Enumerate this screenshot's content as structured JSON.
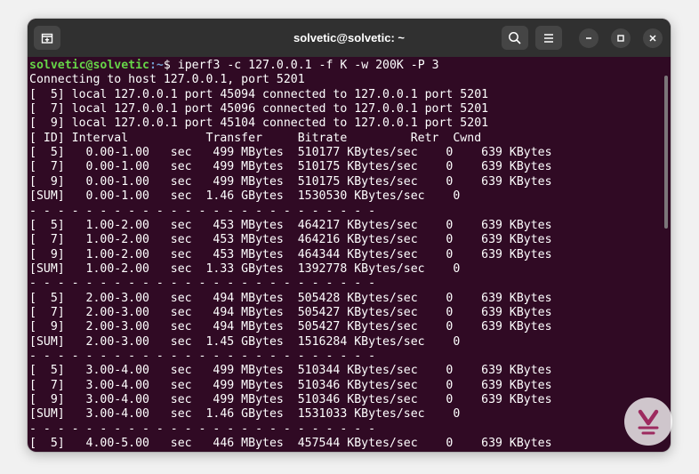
{
  "window": {
    "title": "solvetic@solvetic: ~",
    "colors": {
      "background": "#300a24",
      "titlebar": "#303030",
      "prompt_user": "#66d648",
      "prompt_path": "#729fcf",
      "text": "#ffffff"
    },
    "icons": [
      "new-tab-icon",
      "search-icon",
      "menu-icon",
      "minimize-icon",
      "maximize-icon",
      "close-icon"
    ]
  },
  "terminal": {
    "prompt_user": "solvetic@solvetic",
    "prompt_path": ":~",
    "prompt_symbol": "$ ",
    "command": "iperf3 -c 127.0.0.1 -f K -w 200K -P 3",
    "lines": [
      "Connecting to host 127.0.0.1, port 5201",
      "[  5] local 127.0.0.1 port 45094 connected to 127.0.0.1 port 5201",
      "[  7] local 127.0.0.1 port 45096 connected to 127.0.0.1 port 5201",
      "[  9] local 127.0.0.1 port 45104 connected to 127.0.0.1 port 5201",
      "[ ID] Interval           Transfer     Bitrate         Retr  Cwnd",
      "[  5]   0.00-1.00   sec   499 MBytes  510177 KBytes/sec    0    639 KBytes",
      "[  7]   0.00-1.00   sec   499 MBytes  510175 KBytes/sec    0    639 KBytes",
      "[  9]   0.00-1.00   sec   499 MBytes  510175 KBytes/sec    0    639 KBytes",
      "[SUM]   0.00-1.00   sec  1.46 GBytes  1530530 KBytes/sec    0",
      "- - - - - - - - - - - - - - - - - - - - - - - - -",
      "[  5]   1.00-2.00   sec   453 MBytes  464217 KBytes/sec    0    639 KBytes",
      "[  7]   1.00-2.00   sec   453 MBytes  464216 KBytes/sec    0    639 KBytes",
      "[  9]   1.00-2.00   sec   453 MBytes  464344 KBytes/sec    0    639 KBytes",
      "[SUM]   1.00-2.00   sec  1.33 GBytes  1392778 KBytes/sec    0",
      "- - - - - - - - - - - - - - - - - - - - - - - - -",
      "[  5]   2.00-3.00   sec   494 MBytes  505428 KBytes/sec    0    639 KBytes",
      "[  7]   2.00-3.00   sec   494 MBytes  505427 KBytes/sec    0    639 KBytes",
      "[  9]   2.00-3.00   sec   494 MBytes  505427 KBytes/sec    0    639 KBytes",
      "[SUM]   2.00-3.00   sec  1.45 GBytes  1516284 KBytes/sec    0",
      "- - - - - - - - - - - - - - - - - - - - - - - - -",
      "[  5]   3.00-4.00   sec   499 MBytes  510344 KBytes/sec    0    639 KBytes",
      "[  7]   3.00-4.00   sec   499 MBytes  510346 KBytes/sec    0    639 KBytes",
      "[  9]   3.00-4.00   sec   499 MBytes  510346 KBytes/sec    0    639 KBytes",
      "[SUM]   3.00-4.00   sec  1.46 GBytes  1531033 KBytes/sec    0",
      "- - - - - - - - - - - - - - - - - - - - - - - - -",
      "[  5]   4.00-5.00   sec   446 MBytes  457544 KBytes/sec    0    639 KBytes"
    ]
  }
}
